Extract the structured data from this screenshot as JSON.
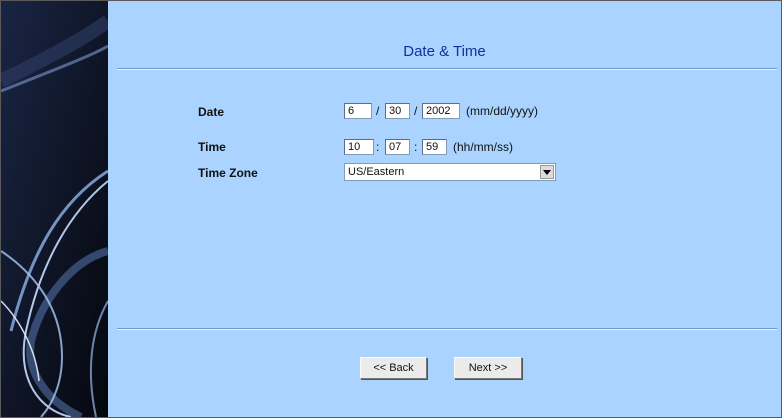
{
  "page": {
    "title": "Date & Time"
  },
  "form": {
    "date": {
      "label": "Date",
      "month": "6",
      "day": "30",
      "year": "2002",
      "separator": "/",
      "format_hint": "(mm/dd/yyyy)"
    },
    "time": {
      "label": "Time",
      "hours": "10",
      "minutes": "07",
      "seconds": "59",
      "separator": ":",
      "format_hint": "(hh/mm/ss)"
    },
    "timezone": {
      "label": "Time Zone",
      "selected": "US/Eastern"
    }
  },
  "buttons": {
    "back": "<< Back",
    "next": "Next >>"
  },
  "colors": {
    "panel": "#aad4ff",
    "title": "#12309a",
    "sidebar": "#0b0f1c"
  },
  "icons": {
    "select_arrow": "chevron-down-icon"
  }
}
